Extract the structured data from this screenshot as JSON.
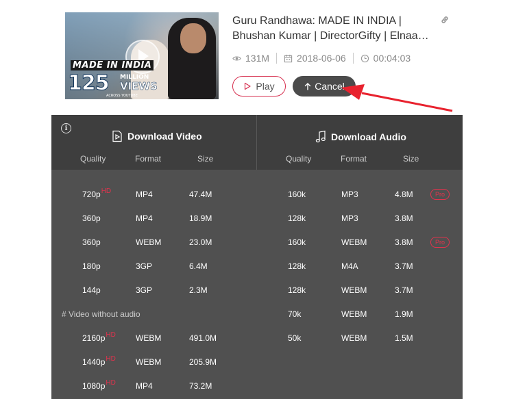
{
  "video": {
    "title_line1": "Guru Randhawa: MADE IN INDIA |",
    "title_line2": "Bhushan Kumar | DirectorGifty | Elnaa…",
    "views": "131M",
    "date": "2018-06-06",
    "duration": "00:04:03",
    "thumbnail": {
      "made_in_india": "MADE IN INDIA",
      "count": "125",
      "million": "MILLION",
      "views_word": "VIEWS",
      "across": "ACROSS YOUTUBE"
    }
  },
  "buttons": {
    "play_label": "Play",
    "cancel_label": "Cancel"
  },
  "download_video": {
    "title": "Download Video",
    "headers": [
      "Quality",
      "Format",
      "Size"
    ],
    "rows": [
      {
        "quality": "720p",
        "hd": "HD",
        "format": "MP4",
        "size": "47.4M"
      },
      {
        "quality": "360p",
        "hd": "",
        "format": "MP4",
        "size": "18.9M"
      },
      {
        "quality": "360p",
        "hd": "",
        "format": "WEBM",
        "size": "23.0M"
      },
      {
        "quality": "180p",
        "hd": "",
        "format": "3GP",
        "size": "6.4M"
      },
      {
        "quality": "144p",
        "hd": "",
        "format": "3GP",
        "size": "2.3M"
      }
    ],
    "no_audio_label": "# Video without audio",
    "no_audio_rows": [
      {
        "quality": "2160p",
        "hd": "HD",
        "format": "WEBM",
        "size": "491.0M"
      },
      {
        "quality": "1440p",
        "hd": "HD",
        "format": "WEBM",
        "size": "205.9M"
      },
      {
        "quality": "1080p",
        "hd": "HD",
        "format": "MP4",
        "size": "73.2M"
      }
    ]
  },
  "download_audio": {
    "title": "Download Audio",
    "headers": [
      "Quality",
      "Format",
      "Size"
    ],
    "rows": [
      {
        "quality": "160k",
        "format": "MP3",
        "size": "4.8M",
        "pro": "Pro"
      },
      {
        "quality": "128k",
        "format": "MP3",
        "size": "3.8M",
        "pro": ""
      },
      {
        "quality": "160k",
        "format": "WEBM",
        "size": "3.8M",
        "pro": "Pro"
      },
      {
        "quality": "128k",
        "format": "M4A",
        "size": "3.7M",
        "pro": ""
      },
      {
        "quality": "128k",
        "format": "WEBM",
        "size": "3.7M",
        "pro": ""
      },
      {
        "quality": "70k",
        "format": "WEBM",
        "size": "1.9M",
        "pro": ""
      },
      {
        "quality": "50k",
        "format": "WEBM",
        "size": "1.5M",
        "pro": ""
      }
    ]
  },
  "colors": {
    "accent": "#d62f4f",
    "panel_bg": "#505050",
    "panel_header_bg": "#3e3e3e",
    "cancel_bg": "#4b4b4b",
    "arrow": "#e8222e"
  },
  "icons": [
    "link-icon",
    "eye-icon",
    "calendar-icon",
    "clock-icon",
    "play-icon",
    "upload-arrow-icon",
    "info-icon",
    "video-file-icon",
    "music-note-icon"
  ]
}
